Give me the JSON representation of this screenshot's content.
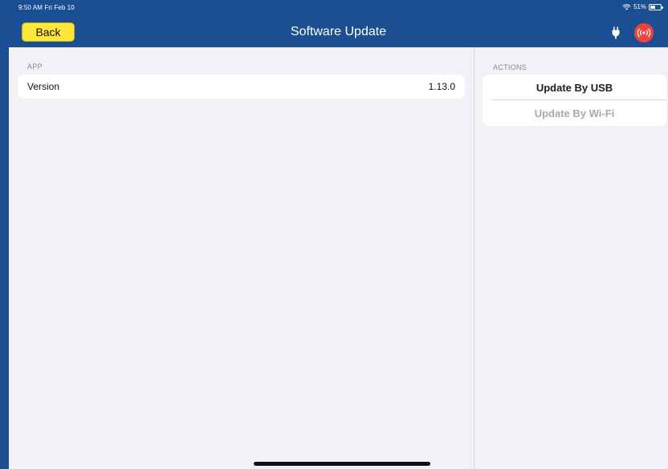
{
  "status_bar": {
    "time_date": "9:50 AM  Fri Feb 10",
    "battery_percent": "51%",
    "battery_level": 0.51
  },
  "nav": {
    "back_label": "Back",
    "title": "Software Update"
  },
  "app_section": {
    "header": "APP",
    "rows": [
      {
        "label": "Version",
        "value": "1.13.0"
      }
    ]
  },
  "actions_section": {
    "header": "ACTIONS",
    "items": [
      {
        "label": "Update By USB",
        "enabled": true
      },
      {
        "label": "Update By Wi-Fi",
        "enabled": false
      }
    ]
  },
  "colors": {
    "header_blue": "#1b4f94",
    "back_button_yellow": "#ffe63a",
    "signal_red": "#f04236",
    "background": "#f2f1f6",
    "disabled_text": "#a9a9ad"
  },
  "icons": [
    "wifi-icon",
    "battery-icon",
    "plug-icon",
    "signal-broadcast-icon"
  ]
}
